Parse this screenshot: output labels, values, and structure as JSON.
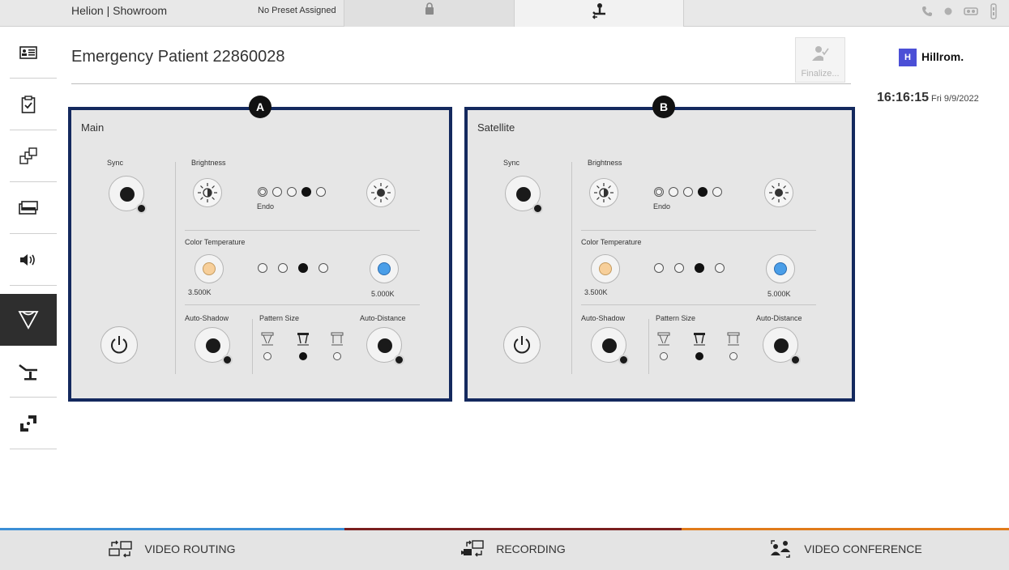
{
  "topbar": {
    "app_title": "Helion | Showroom",
    "preset": "No Preset Assigned"
  },
  "sidebar": {
    "items": [
      {
        "icon": "patient-card-icon"
      },
      {
        "icon": "checklist-icon"
      },
      {
        "icon": "layout-icon"
      },
      {
        "icon": "display-icon"
      },
      {
        "icon": "audio-icon"
      },
      {
        "icon": "surgical-light-icon",
        "active": true
      },
      {
        "icon": "operating-table-icon"
      },
      {
        "icon": "camera-icon"
      }
    ]
  },
  "header": {
    "patient_title": "Emergency Patient 22860028",
    "finalize_label": "Finalize...",
    "logo_text": "Hillrom.",
    "logo_mark": "H",
    "time": "16:16:15",
    "date": "Fri 9/9/2022"
  },
  "panels": [
    {
      "marker": "A",
      "name": "Main",
      "sync_label": "Sync",
      "brightness_label": "Brightness",
      "endo_label": "Endo",
      "brightness_level": 4,
      "color_temperature_label": "Color Temperature",
      "temp_low": "3.500K",
      "temp_high": "5.000K",
      "temp_level": 3,
      "auto_shadow_label": "Auto-Shadow",
      "pattern_size_label": "Pattern Size",
      "auto_distance_label": "Auto-Distance",
      "pattern_selected": 2
    },
    {
      "marker": "B",
      "name": "Satellite",
      "sync_label": "Sync",
      "brightness_label": "Brightness",
      "endo_label": "Endo",
      "brightness_level": 4,
      "color_temperature_label": "Color Temperature",
      "temp_low": "3.500K",
      "temp_high": "5.000K",
      "temp_level": 3,
      "auto_shadow_label": "Auto-Shadow",
      "pattern_size_label": "Pattern Size",
      "auto_distance_label": "Auto-Distance",
      "pattern_selected": 2
    }
  ],
  "bottom_tabs": [
    {
      "label": "VIDEO ROUTING",
      "accent": "#3b8fd6",
      "icon": "video-routing-icon"
    },
    {
      "label": "RECORDING",
      "accent": "#7a1f1f",
      "icon": "recording-icon"
    },
    {
      "label": "VIDEO CONFERENCE",
      "accent": "#e07b1a",
      "icon": "video-conference-icon"
    }
  ],
  "colors": {
    "panel_border": "#14295e",
    "warm_light": "#f7cf9a",
    "cool_light": "#4a9ee8",
    "active_sidebar": "#2e2e2e"
  }
}
